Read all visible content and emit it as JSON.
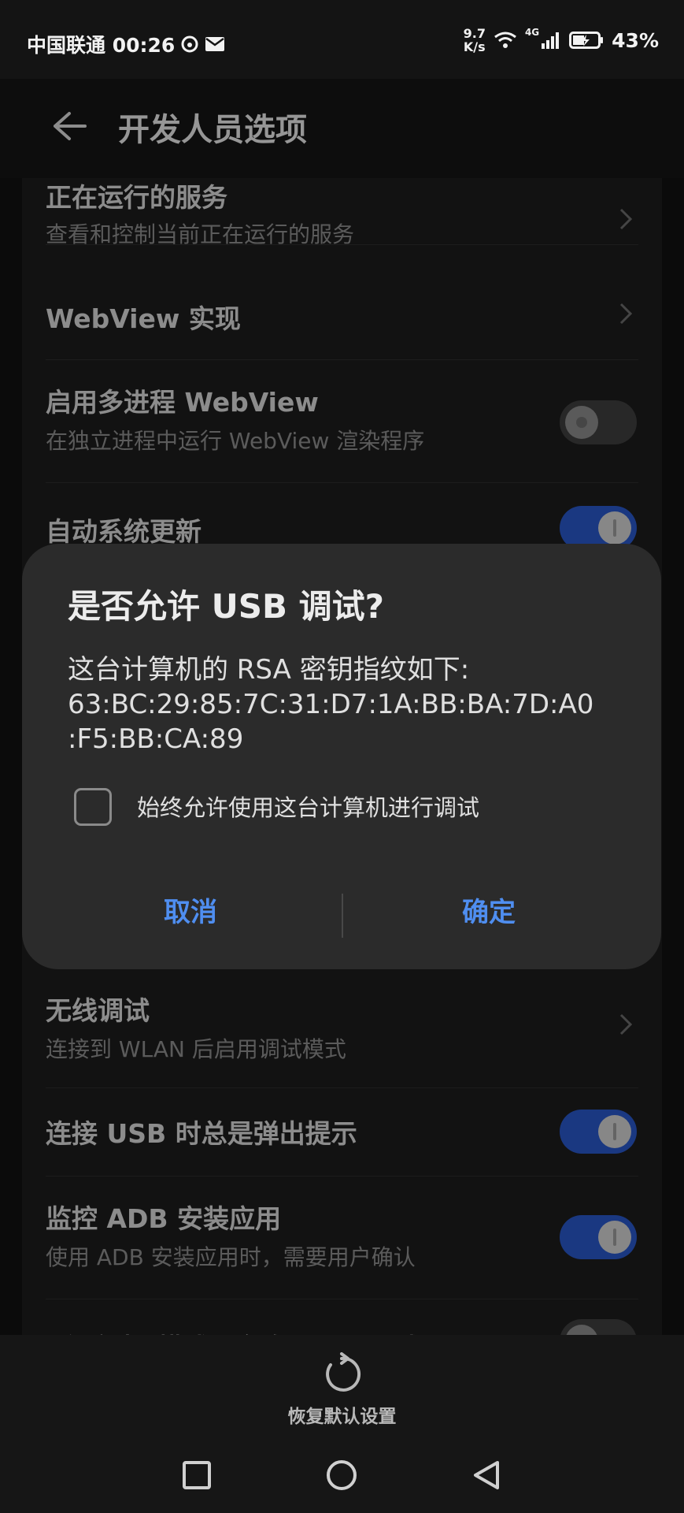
{
  "status_bar": {
    "carrier_time": "中国联通 00:26",
    "net_speed_value": "9.7",
    "net_speed_unit": "K/s",
    "network_type": "4G",
    "battery": "43%"
  },
  "header": {
    "title": "开发人员选项"
  },
  "settings": [
    {
      "title": "正在运行的服务",
      "subtitle": "查看和控制当前正在运行的服务",
      "control": "chevron"
    },
    {
      "title": "WebView 实现",
      "control": "chevron"
    },
    {
      "title": "启用多进程 WebView",
      "subtitle": "在独立进程中运行 WebView 渲染程序",
      "control": "toggle",
      "state": "off"
    },
    {
      "title": "自动系统更新",
      "control": "toggle",
      "state": "on"
    },
    {
      "title": "无线调试",
      "subtitle": "连接到 WLAN 后启用调试模式",
      "control": "chevron"
    },
    {
      "title": "连接 USB 时总是弹出提示",
      "control": "toggle",
      "state": "on"
    },
    {
      "title": "监控 ADB 安装应用",
      "subtitle": "使用 ADB 安装应用时，需要用户确认",
      "control": "toggle",
      "state": "on"
    },
    {
      "title": "“仅充电”模式下允许 ADB 调试",
      "control": "toggle",
      "state": "off"
    }
  ],
  "dialog": {
    "title": "是否允许 USB 调试?",
    "message_line1": "这台计算机的 RSA 密钥指纹如下:",
    "message_line2": "63:BC:29:85:7C:31:D7:1A:BB:BA:7D:A0",
    "message_line3": ":F5:BB:CA:89",
    "checkbox_label": "始终允许使用这台计算机进行调试",
    "checkbox_checked": false,
    "cancel": "取消",
    "confirm": "确定"
  },
  "bottom": {
    "reset_label": "恢复默认设置"
  },
  "colors": {
    "accent": "#2957c7",
    "link": "#4f8ef0",
    "background": "#111111",
    "dialog": "#2b2b2b"
  }
}
